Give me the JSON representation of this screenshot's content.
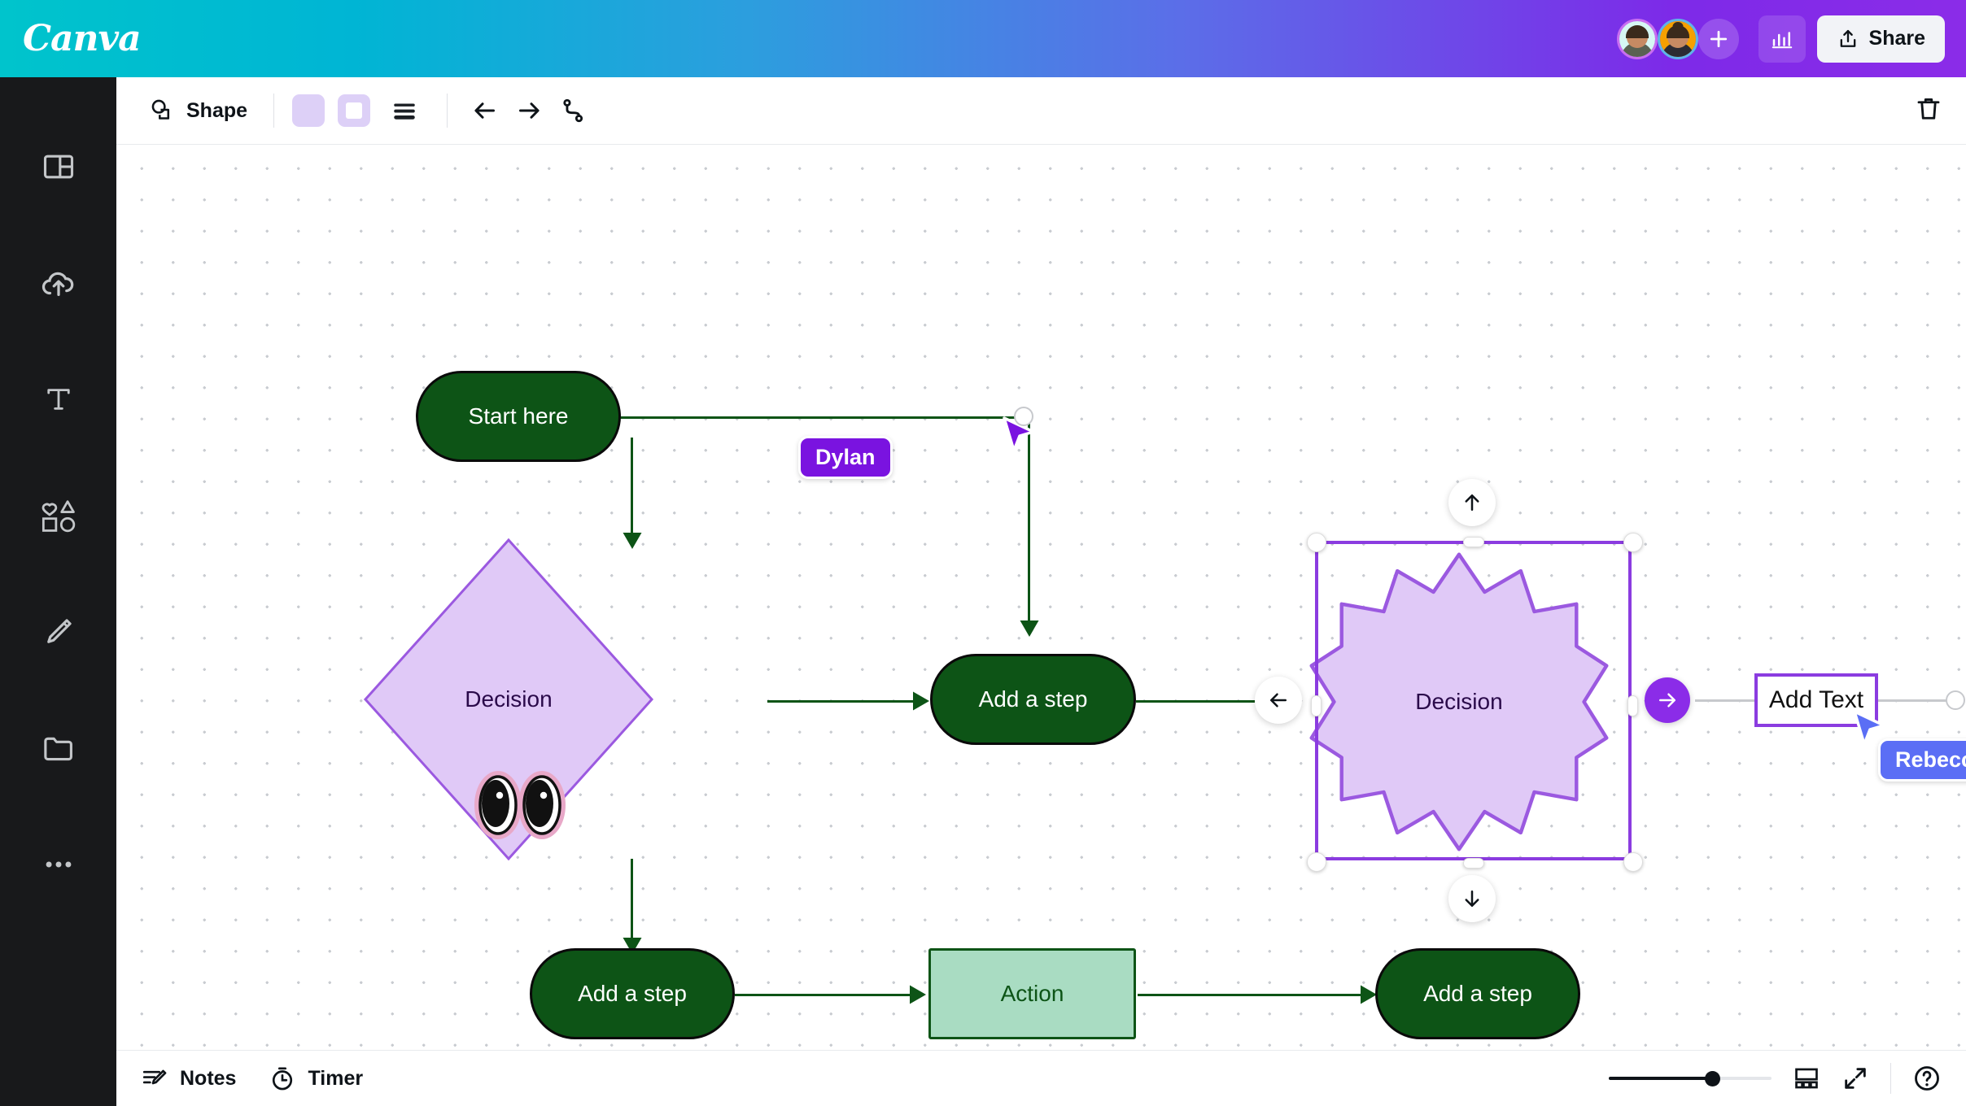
{
  "header": {
    "logo": "Canva",
    "share_label": "Share",
    "add_collaborator_icon": "plus-icon",
    "insights_icon": "bar-chart-icon",
    "share_icon": "share-upload-icon",
    "avatars": [
      {
        "name": "collaborator-1",
        "ring_color": "#c96ef0",
        "bg": "#d6f7f4"
      },
      {
        "name": "collaborator-2",
        "ring_color": "#5fb4e8",
        "bg": "#f5a000"
      }
    ],
    "gradient_from": "#00c4cc",
    "gradient_to": "#8b2ce8"
  },
  "sidebar": {
    "items": [
      {
        "icon": "design-layout-icon",
        "name": "design"
      },
      {
        "icon": "upload-cloud-icon",
        "name": "uploads"
      },
      {
        "icon": "text-t-icon",
        "name": "text"
      },
      {
        "icon": "elements-shapes-icon",
        "name": "elements"
      },
      {
        "icon": "pencil-draw-icon",
        "name": "draw"
      },
      {
        "icon": "folder-icon",
        "name": "projects"
      },
      {
        "icon": "more-dots-icon",
        "name": "apps"
      }
    ]
  },
  "toolbar": {
    "shape_label": "Shape",
    "shape_icon": "shape-icon",
    "fill_color": "#ddd0f7",
    "border_color": "#ddd0f7",
    "line_style_icon": "line-weight-icon",
    "arrow_left_icon": "arrow-left-icon",
    "arrow_right_icon": "arrow-right-icon",
    "elbow_connector_icon": "elbow-connector-icon",
    "trash_icon": "trash-icon"
  },
  "canvas": {
    "grid_dot_color": "#c9ccd1",
    "node_green_fill": "#0d5416",
    "node_green_text": "#ffffff",
    "action_fill": "#a9dcc2",
    "action_stroke": "#0d5416",
    "shape_purple_fill": "#e0c9f7",
    "shape_purple_stroke": "#9b59e0",
    "shape_purple_text": "#2a0a4a",
    "selection_color": "#8b3ce0",
    "nodes": [
      {
        "id": "start",
        "label": "Start here",
        "type": "pill"
      },
      {
        "id": "decision-diamond",
        "label": "Decision",
        "type": "diamond"
      },
      {
        "id": "add-step-mid",
        "label": "Add a step",
        "type": "pill"
      },
      {
        "id": "decision-star",
        "label": "Decision",
        "type": "starburst"
      },
      {
        "id": "add-step-bottom-left",
        "label": "Add a step",
        "type": "pill"
      },
      {
        "id": "action",
        "label": "Action",
        "type": "rectangle"
      },
      {
        "id": "add-step-bottom-right",
        "label": "Add a step",
        "type": "pill"
      }
    ],
    "text_box": {
      "label": "Add Text",
      "placeholder": "Add Text"
    },
    "sticker": {
      "name": "eyes-emoji",
      "glyph": "👀"
    },
    "quick_actions": [
      {
        "name": "add-node-up",
        "icon": "arrow-up-icon"
      },
      {
        "name": "add-node-down",
        "icon": "arrow-down-icon"
      },
      {
        "name": "add-node-left",
        "icon": "arrow-left-icon"
      },
      {
        "name": "add-node-right",
        "icon": "arrow-right-icon",
        "accent": "#8b2ce8"
      }
    ],
    "cursors": [
      {
        "name": "Dylan",
        "color": "#7a13e0"
      },
      {
        "name": "Rebecca",
        "color": "#5b6ef5"
      }
    ]
  },
  "bottombar": {
    "notes_label": "Notes",
    "notes_icon": "notes-pencil-icon",
    "timer_label": "Timer",
    "timer_icon": "timer-icon",
    "zoom_value": 60,
    "grid_view_icon": "grid-view-icon",
    "fullscreen_icon": "fullscreen-icon",
    "help_icon": "help-circle-icon"
  }
}
